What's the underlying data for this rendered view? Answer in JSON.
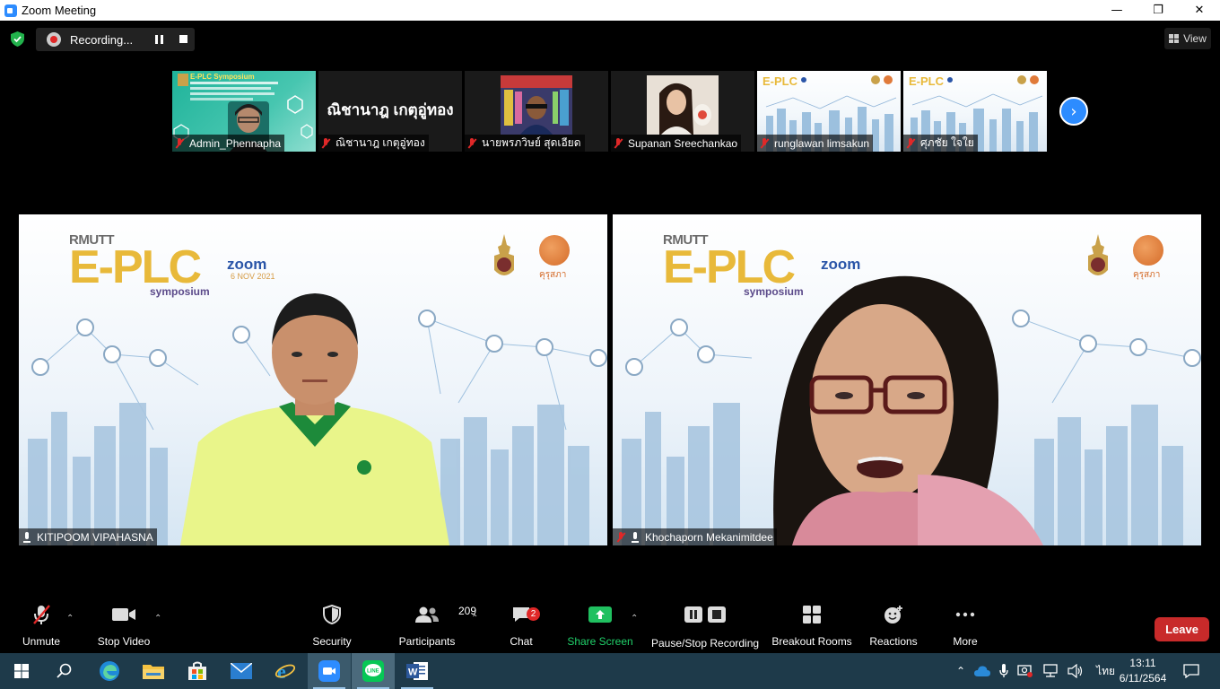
{
  "window": {
    "title": "Zoom Meeting",
    "minimize": "—",
    "maximize": "❐",
    "close": "✕"
  },
  "topbar": {
    "recording_label": "Recording...",
    "view_label": "View"
  },
  "thumbnails": [
    {
      "name": "Admin_Phennapha",
      "muted": true,
      "banner": "E-PLC Symposium"
    },
    {
      "name": "ณิชานาฎ เกตุอู่ทอง",
      "muted": true,
      "display_name": "ณิชานาฎ เกตุอู่ทอง"
    },
    {
      "name": "นายพรภวิษย์ สุดเอียด",
      "muted": true
    },
    {
      "name": "Supanan Sreechankao",
      "muted": true
    },
    {
      "name": "runglawan limsakun",
      "muted": true
    },
    {
      "name": "ศุภชัย ใจใย",
      "muted": true
    }
  ],
  "slide": {
    "rmutt": "RMUTT",
    "eplc": "E-PLC",
    "symposium": "symposium",
    "zoom": "zoom",
    "date": "6 NOV 2021",
    "kurusapa": "คุรุสภา"
  },
  "speakers": [
    {
      "name": "KITIPOOM VIPAHASNA",
      "muted": false
    },
    {
      "name": "Khochaporn Mekanimitdee",
      "muted": true
    }
  ],
  "toolbar": {
    "unmute": "Unmute",
    "stop_video": "Stop Video",
    "security": "Security",
    "participants": "Participants",
    "participants_count": "209",
    "chat": "Chat",
    "chat_badge": "2",
    "share_screen": "Share Screen",
    "pause_stop_recording": "Pause/Stop Recording",
    "breakout_rooms": "Breakout Rooms",
    "reactions": "Reactions",
    "more": "More",
    "leave": "Leave"
  },
  "taskbar": {
    "language": "ไทย",
    "time": "13:11",
    "date": "6/11/2564"
  },
  "colors": {
    "accent": "#2d8cff",
    "leave": "#c82a2a",
    "share_green": "#20d06a",
    "muted_red": "#e02828"
  }
}
